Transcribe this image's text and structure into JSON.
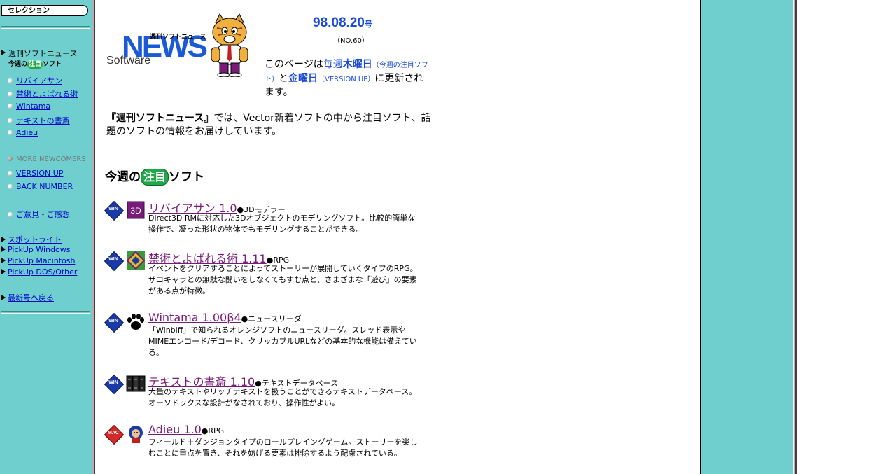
{
  "sidebar": {
    "title": "セレクション",
    "heading": "週刊ソフトニュース",
    "subheading_pre": "今週の",
    "subheading_mark": "注目",
    "subheading_post": "ソフト",
    "items": [
      {
        "label": "リバイアサン"
      },
      {
        "label": "禁術とよばれる術"
      },
      {
        "label": "Wintama"
      },
      {
        "label": "テキストの書斎"
      },
      {
        "label": "Adieu"
      }
    ],
    "more_newcomers": "MORE NEWCOMERS",
    "version_up": "VERSION UP",
    "back_number": "BACK NUMBER",
    "feedback": "ご意見・ご感想",
    "spotlight": "スポットライト",
    "pickup_windows": "PickUp Windows",
    "pickup_macintosh": "PickUp Macintosh",
    "pickup_dos": "PickUp DOS/Other",
    "latest": "最新号へ戻る"
  },
  "header": {
    "logo_small": "週刊ソフトニュース",
    "logo_news": "NEWS",
    "logo_software": "Software",
    "issue_date": "98.08.20",
    "issue_suffix": "号",
    "issue_no": "（NO.60）",
    "note_1": "このページは",
    "note_2": "毎週",
    "note_3": "木曜日",
    "note_4": "（今週の注目ソフト）",
    "note_5": "と",
    "note_6": "金曜日",
    "note_7": "（VERSION UP）",
    "note_8": "に更新されます。"
  },
  "intro": {
    "title": "『週刊ソフトニュース』",
    "text": "では、Vector新着ソフトの中から注目ソフト、話題のソフトの情報をお届けしています。"
  },
  "section": {
    "pre": "今週の",
    "mark": "注目",
    "post": "ソフト"
  },
  "entries": [
    {
      "os": "WIN",
      "title": "リバイアサン 1.0",
      "category": "●3Dモデラー",
      "desc": "Direct3D RMに対応した3Dオブジェクトのモデリングソフト。比較的簡単な操作で、凝った形状の物体でもモデリングすることができる。"
    },
    {
      "os": "WIN",
      "title": "禁術とよばれる術 1.11",
      "category": "●RPG",
      "desc": "イベントをクリアすることによってストーリーが展開していくタイプのRPG。ザコキャラとの無駄な闘いをしなくてもすむ点と、さまざまな「遊び」の要素がある点が特徴。"
    },
    {
      "os": "WIN",
      "title": "Wintama 1.00β4",
      "category": "●ニュースリーダ",
      "desc": "「Winbiff」で知られるオレンジソフトのニュースリーダ。スレッド表示やMIMEエンコード/デコード、クリッカブルURLなどの基本的な機能は備えている。"
    },
    {
      "os": "WIN",
      "title": "テキストの書斎 1.10",
      "category": "●テキストデータベース",
      "desc": "大量のテキストやリッチテキストを扱うことができるテキストデータベース。オーソドックスな設計がなされており、操作性がよい。"
    },
    {
      "os": "MAC",
      "title": "Adieu 1.0",
      "category": "●RPG",
      "desc": "フィールド＋ダンジョンタイプのロールプレイングゲーム。ストーリーを楽しむことに重点を置き、それを妨げる要素は排除するよう配慮されている。"
    }
  ],
  "colors": {
    "sidebar_bg": "#6fcfcf",
    "link": "#0000cc",
    "title_link": "#7a1a7a",
    "brand_blue": "#1a5ad6",
    "chu_green": "#22a848"
  }
}
